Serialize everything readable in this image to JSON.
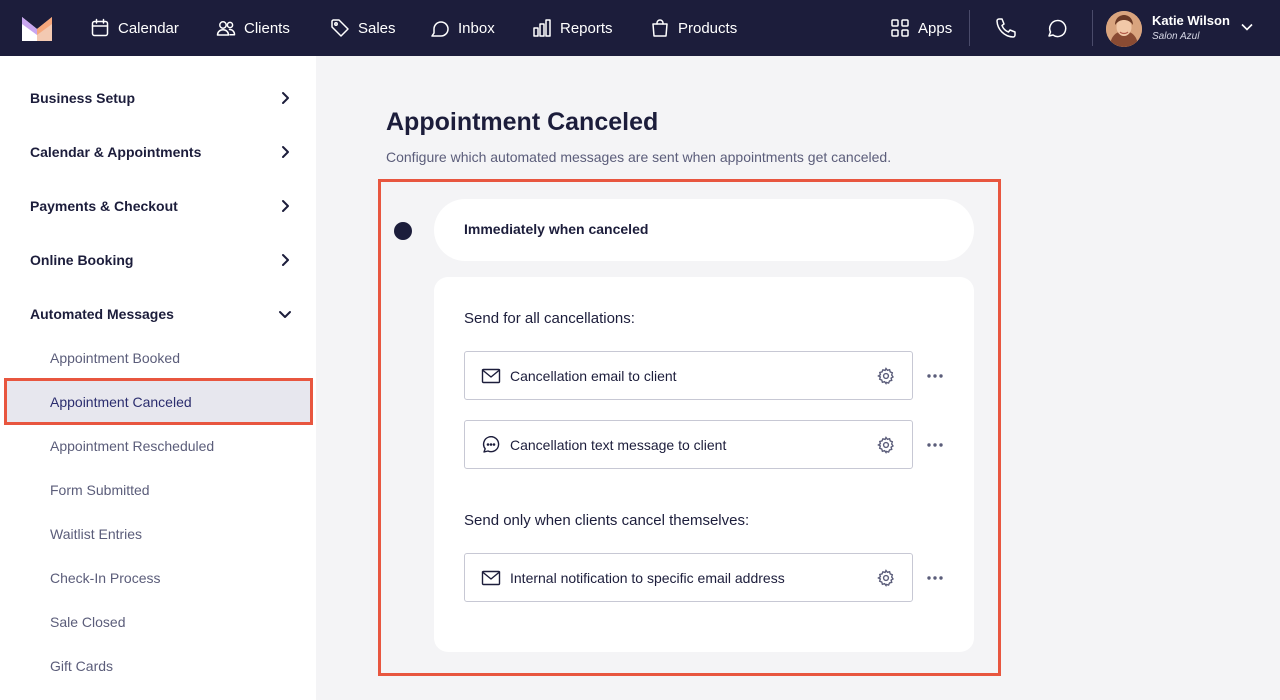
{
  "colors": {
    "nav_bg": "#1c1d3b",
    "accent_highlight": "#e8563f",
    "active_bg": "#e7e7ee"
  },
  "nav": {
    "items": [
      {
        "label": "Calendar",
        "icon": "calendar-icon"
      },
      {
        "label": "Clients",
        "icon": "users-icon"
      },
      {
        "label": "Sales",
        "icon": "tag-icon"
      },
      {
        "label": "Inbox",
        "icon": "inbox-icon"
      },
      {
        "label": "Reports",
        "icon": "bar-chart-icon"
      },
      {
        "label": "Products",
        "icon": "bag-icon"
      }
    ],
    "apps_label": "Apps",
    "user": {
      "name": "Katie Wilson",
      "org": "Salon Azul"
    }
  },
  "sidebar": {
    "sections": [
      {
        "label": "Business Setup",
        "expanded": false
      },
      {
        "label": "Calendar & Appointments",
        "expanded": false
      },
      {
        "label": "Payments & Checkout",
        "expanded": false
      },
      {
        "label": "Online Booking",
        "expanded": false
      },
      {
        "label": "Automated Messages",
        "expanded": true
      }
    ],
    "subitems": [
      "Appointment Booked",
      "Appointment Canceled",
      "Appointment Rescheduled",
      "Form Submitted",
      "Waitlist Entries",
      "Check-In Process",
      "Sale Closed",
      "Gift Cards"
    ],
    "active_subitem": "Appointment Canceled"
  },
  "main": {
    "title": "Appointment Canceled",
    "description": "Configure which automated messages are sent when appointments get canceled.",
    "trigger": "Immediately when canceled",
    "groups": [
      {
        "title": "Send for all cancellations:",
        "messages": [
          {
            "label": "Cancellation email to client",
            "icon": "mail-icon"
          },
          {
            "label": "Cancellation text message to client",
            "icon": "chat-bubble-icon"
          }
        ]
      },
      {
        "title": "Send only when clients cancel themselves:",
        "messages": [
          {
            "label": "Internal notification to specific email address",
            "icon": "mail-icon"
          }
        ]
      }
    ]
  }
}
